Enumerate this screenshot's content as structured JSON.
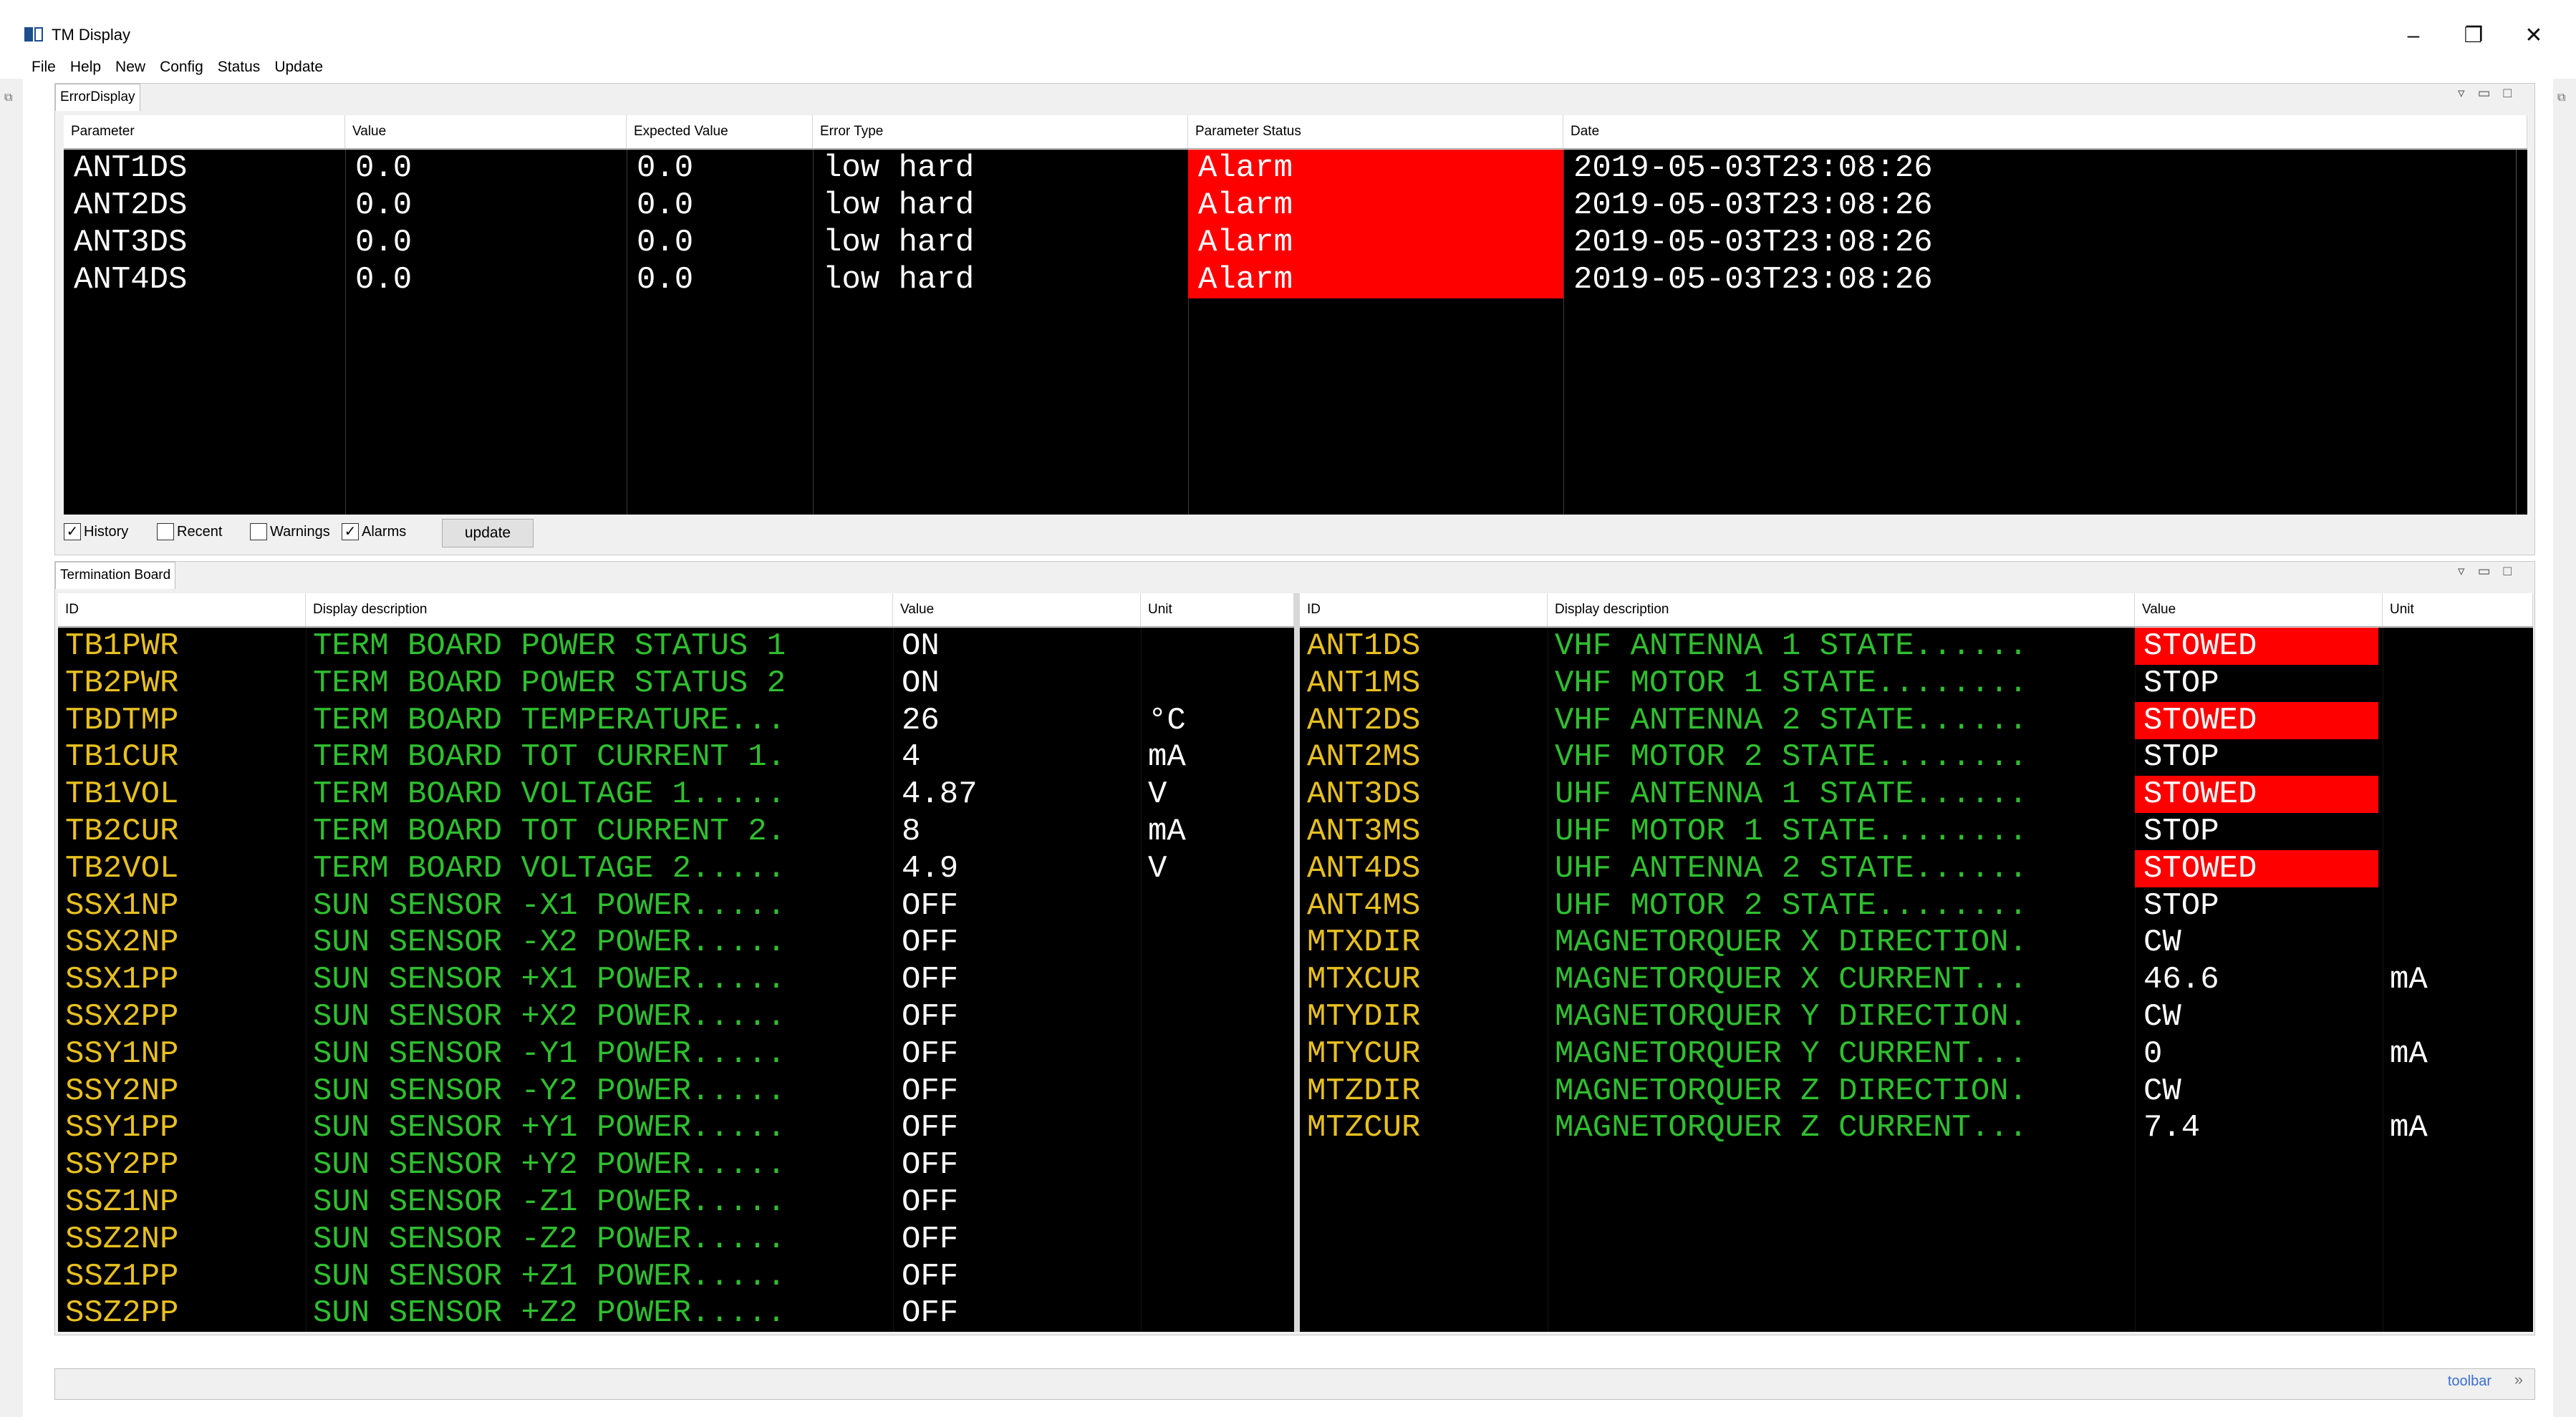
{
  "window": {
    "title": "TM Display",
    "controls": {
      "minimize": "–",
      "restore": "❐",
      "close": "✕"
    }
  },
  "menu": [
    "File",
    "Help",
    "New",
    "Config",
    "Status",
    "Update"
  ],
  "error_display": {
    "tab_label": "ErrorDisplay",
    "columns": [
      "Parameter",
      "Value",
      "Expected Value",
      "Error Type",
      "Parameter Status",
      "Date"
    ],
    "rows": [
      {
        "parameter": "ANT1DS",
        "value": "0.0",
        "expected": "0.0",
        "error_type": "low hard",
        "status": "Alarm",
        "date": "2019-05-03T23:08:26"
      },
      {
        "parameter": "ANT2DS",
        "value": "0.0",
        "expected": "0.0",
        "error_type": "low hard",
        "status": "Alarm",
        "date": "2019-05-03T23:08:26"
      },
      {
        "parameter": "ANT3DS",
        "value": "0.0",
        "expected": "0.0",
        "error_type": "low hard",
        "status": "Alarm",
        "date": "2019-05-03T23:08:26"
      },
      {
        "parameter": "ANT4DS",
        "value": "0.0",
        "expected": "0.0",
        "error_type": "low hard",
        "status": "Alarm",
        "date": "2019-05-03T23:08:26"
      }
    ],
    "filters": [
      {
        "label": "History",
        "checked": true
      },
      {
        "label": "Recent",
        "checked": false
      },
      {
        "label": "Warnings",
        "checked": false
      },
      {
        "label": "Alarms",
        "checked": true
      }
    ],
    "update_label": "update"
  },
  "termination_board": {
    "tab_label": "Termination Board",
    "columns": [
      "ID",
      "Display description",
      "Value",
      "Unit"
    ],
    "left_rows": [
      {
        "id": "TB1PWR",
        "desc": "TERM BOARD POWER STATUS 1",
        "value": "ON",
        "unit": ""
      },
      {
        "id": "TB2PWR",
        "desc": "TERM BOARD POWER STATUS 2",
        "value": "ON",
        "unit": ""
      },
      {
        "id": "TBDTMP",
        "desc": "TERM BOARD TEMPERATURE...",
        "value": "26",
        "unit": "°C"
      },
      {
        "id": "TB1CUR",
        "desc": "TERM BOARD TOT CURRENT 1.",
        "value": "4",
        "unit": "mA"
      },
      {
        "id": "TB1VOL",
        "desc": "TERM BOARD VOLTAGE 1.....",
        "value": "4.87",
        "unit": "V"
      },
      {
        "id": "TB2CUR",
        "desc": "TERM BOARD TOT CURRENT 2.",
        "value": "8",
        "unit": "mA"
      },
      {
        "id": "TB2VOL",
        "desc": "TERM BOARD VOLTAGE 2.....",
        "value": "4.9",
        "unit": "V"
      },
      {
        "id": "SSX1NP",
        "desc": "SUN SENSOR -X1 POWER.....",
        "value": "OFF",
        "unit": ""
      },
      {
        "id": "SSX2NP",
        "desc": "SUN SENSOR -X2 POWER.....",
        "value": "OFF",
        "unit": ""
      },
      {
        "id": "SSX1PP",
        "desc": "SUN SENSOR +X1 POWER.....",
        "value": "OFF",
        "unit": ""
      },
      {
        "id": "SSX2PP",
        "desc": "SUN SENSOR +X2 POWER.....",
        "value": "OFF",
        "unit": ""
      },
      {
        "id": "SSY1NP",
        "desc": "SUN SENSOR -Y1 POWER.....",
        "value": "OFF",
        "unit": ""
      },
      {
        "id": "SSY2NP",
        "desc": "SUN SENSOR -Y2 POWER.....",
        "value": "OFF",
        "unit": ""
      },
      {
        "id": "SSY1PP",
        "desc": "SUN SENSOR +Y1 POWER.....",
        "value": "OFF",
        "unit": ""
      },
      {
        "id": "SSY2PP",
        "desc": "SUN SENSOR +Y2 POWER.....",
        "value": "OFF",
        "unit": ""
      },
      {
        "id": "SSZ1NP",
        "desc": "SUN SENSOR -Z1 POWER.....",
        "value": "OFF",
        "unit": ""
      },
      {
        "id": "SSZ2NP",
        "desc": "SUN SENSOR -Z2 POWER.....",
        "value": "OFF",
        "unit": ""
      },
      {
        "id": "SSZ1PP",
        "desc": "SUN SENSOR +Z1 POWER.....",
        "value": "OFF",
        "unit": ""
      },
      {
        "id": "SSZ2PP",
        "desc": "SUN SENSOR +Z2 POWER.....",
        "value": "OFF",
        "unit": ""
      }
    ],
    "right_rows": [
      {
        "id": "ANT1DS",
        "desc": "VHF ANTENNA 1 STATE......",
        "value": "STOWED",
        "unit": "",
        "alarm": true
      },
      {
        "id": "ANT1MS",
        "desc": "VHF MOTOR 1 STATE........",
        "value": "STOP",
        "unit": "",
        "alarm": false
      },
      {
        "id": "ANT2DS",
        "desc": "VHF ANTENNA 2 STATE......",
        "value": "STOWED",
        "unit": "",
        "alarm": true
      },
      {
        "id": "ANT2MS",
        "desc": "VHF MOTOR 2 STATE........",
        "value": "STOP",
        "unit": "",
        "alarm": false
      },
      {
        "id": "ANT3DS",
        "desc": "UHF ANTENNA 1 STATE......",
        "value": "STOWED",
        "unit": "",
        "alarm": true
      },
      {
        "id": "ANT3MS",
        "desc": "UHF MOTOR 1 STATE........",
        "value": "STOP",
        "unit": "",
        "alarm": false
      },
      {
        "id": "ANT4DS",
        "desc": "UHF ANTENNA 2 STATE......",
        "value": "STOWED",
        "unit": "",
        "alarm": true
      },
      {
        "id": "ANT4MS",
        "desc": "UHF MOTOR 2 STATE........",
        "value": "STOP",
        "unit": "",
        "alarm": false
      },
      {
        "id": "MTXDIR",
        "desc": "MAGNETORQUER X DIRECTION.",
        "value": "CW",
        "unit": "",
        "alarm": false
      },
      {
        "id": "MTXCUR",
        "desc": "MAGNETORQUER X CURRENT...",
        "value": "46.6",
        "unit": "mA",
        "alarm": false
      },
      {
        "id": "MTYDIR",
        "desc": "MAGNETORQUER Y DIRECTION.",
        "value": "CW",
        "unit": "",
        "alarm": false
      },
      {
        "id": "MTYCUR",
        "desc": "MAGNETORQUER Y CURRENT...",
        "value": "0",
        "unit": "mA",
        "alarm": false
      },
      {
        "id": "MTZDIR",
        "desc": "MAGNETORQUER Z DIRECTION.",
        "value": "CW",
        "unit": "",
        "alarm": false
      },
      {
        "id": "MTZCUR",
        "desc": "MAGNETORQUER Z CURRENT...",
        "value": "7.4",
        "unit": "mA",
        "alarm": false
      }
    ]
  },
  "status_bar": {
    "toolbar_label": "toolbar",
    "chevron": "»"
  },
  "colors": {
    "alarm": "#ff0000",
    "id_text": "#e8c020",
    "desc_text": "#2fbf2f",
    "value_text": "#ffffff",
    "panel_bg": "#000000"
  },
  "icons": {
    "dock_float": "dock-float-icon",
    "dock_menu": "dock-menu-icon",
    "dock_minimize": "dock-minimize-icon",
    "dock_maximize": "dock-maximize-icon"
  }
}
